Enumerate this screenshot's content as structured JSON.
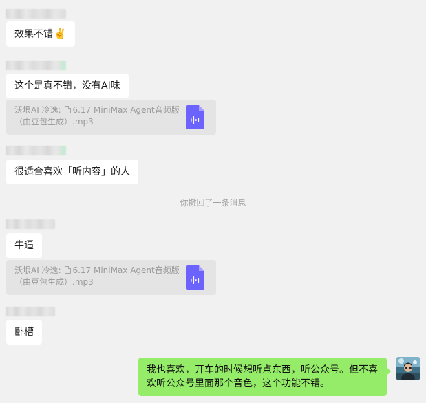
{
  "messages": {
    "m1": {
      "text": "效果不错",
      "emoji": "✌️"
    },
    "m2": {
      "text": "这个是真不错，没有AI味"
    },
    "file1": {
      "prefix": "沃垠AI 冷逸:",
      "title": "6.17 MiniMax Agent音频版",
      "subtitle": "（由豆包生成）.mp3"
    },
    "m3": {
      "text": "很适合喜欢「听内容」的人"
    },
    "system": {
      "text": "你撤回了一条消息"
    },
    "m4": {
      "text": "牛逼"
    },
    "file2": {
      "prefix": "沃垠AI 冷逸:",
      "title": "6.17 MiniMax Agent音频版",
      "subtitle": "（由豆包生成）.mp3"
    },
    "m5": {
      "text": "卧槽"
    },
    "mine": {
      "text": "我也喜欢，开车的时候想听点东西，听公众号。但不喜欢听公众号里面那个音色，这个功能不错。"
    }
  },
  "icons": {
    "file_icon": "audio-file-icon",
    "file_icon_color": "#6c63ff",
    "self_bubble_color": "#95ec69"
  }
}
